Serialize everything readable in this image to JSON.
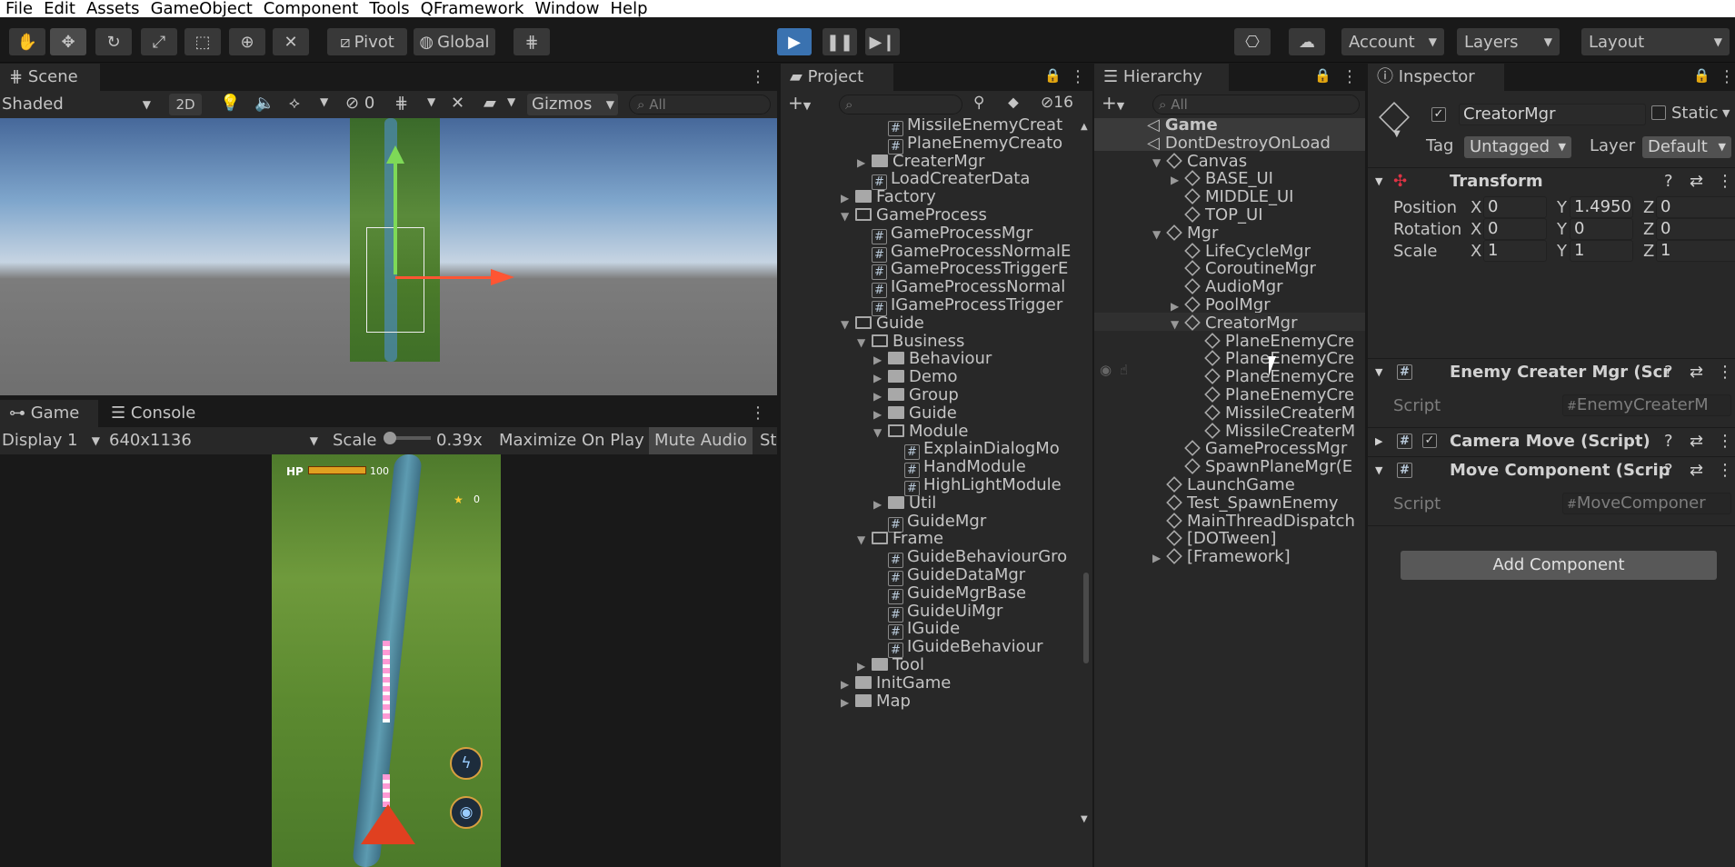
{
  "menu": [
    "File",
    "Edit",
    "Assets",
    "GameObject",
    "Component",
    "Tools",
    "QFramework",
    "Window",
    "Help"
  ],
  "toolbar": {
    "pivot": "Pivot",
    "global": "Global",
    "account": "Account",
    "layers": "Layers",
    "layout": "Layout"
  },
  "scene": {
    "tab": "Scene",
    "shading": "Shaded",
    "mode2d": "2D",
    "hidden_count": "0",
    "gizmos": "Gizmos",
    "search_placeholder": "All"
  },
  "game": {
    "tab": "Game",
    "console_tab": "Console",
    "display": "Display 1",
    "resolution": "640x1136",
    "scale_label": "Scale",
    "scale_value": "0.39x",
    "maximize": "Maximize On Play",
    "mute": "Mute Audio",
    "stats": "St",
    "hp_label": "HP",
    "hp_value": "100",
    "score": "0"
  },
  "project": {
    "tab": "Project",
    "hidden_count": "16",
    "items": [
      {
        "label": "MissileEnemyCreat",
        "indent": 128,
        "kind": "script"
      },
      {
        "label": "PlaneEnemyCreato",
        "indent": 128,
        "kind": "script"
      },
      {
        "label": "CreaterMgr",
        "indent": 110,
        "kind": "folder",
        "arrow": "▶"
      },
      {
        "label": "LoadCreaterData",
        "indent": 110,
        "kind": "script"
      },
      {
        "label": "Factory",
        "indent": 92,
        "kind": "folder",
        "arrow": "▶"
      },
      {
        "label": "GameProcess",
        "indent": 92,
        "kind": "folderopen",
        "arrow": "▼"
      },
      {
        "label": "GameProcessMgr",
        "indent": 110,
        "kind": "script"
      },
      {
        "label": "GameProcessNormalE",
        "indent": 110,
        "kind": "script"
      },
      {
        "label": "GameProcessTriggerE",
        "indent": 110,
        "kind": "script"
      },
      {
        "label": "IGameProcessNormal",
        "indent": 110,
        "kind": "script"
      },
      {
        "label": "IGameProcessTrigger",
        "indent": 110,
        "kind": "script"
      },
      {
        "label": "Guide",
        "indent": 92,
        "kind": "folderopen",
        "arrow": "▼"
      },
      {
        "label": "Business",
        "indent": 110,
        "kind": "folderopen",
        "arrow": "▼"
      },
      {
        "label": "Behaviour",
        "indent": 128,
        "kind": "folder",
        "arrow": "▶"
      },
      {
        "label": "Demo",
        "indent": 128,
        "kind": "folder",
        "arrow": "▶"
      },
      {
        "label": "Group",
        "indent": 128,
        "kind": "folder",
        "arrow": "▶"
      },
      {
        "label": "Guide",
        "indent": 128,
        "kind": "folder",
        "arrow": "▶"
      },
      {
        "label": "Module",
        "indent": 128,
        "kind": "folderopen",
        "arrow": "▼"
      },
      {
        "label": "ExplainDialogMo",
        "indent": 146,
        "kind": "script"
      },
      {
        "label": "HandModule",
        "indent": 146,
        "kind": "script"
      },
      {
        "label": "HighLightModule",
        "indent": 146,
        "kind": "script"
      },
      {
        "label": "Util",
        "indent": 128,
        "kind": "folder",
        "arrow": "▶"
      },
      {
        "label": "GuideMgr",
        "indent": 128,
        "kind": "script"
      },
      {
        "label": "Frame",
        "indent": 110,
        "kind": "folderopen",
        "arrow": "▼"
      },
      {
        "label": "GuideBehaviourGro",
        "indent": 128,
        "kind": "script"
      },
      {
        "label": "GuideDataMgr",
        "indent": 128,
        "kind": "script"
      },
      {
        "label": "GuideMgrBase",
        "indent": 128,
        "kind": "script"
      },
      {
        "label": "GuideUiMgr",
        "indent": 128,
        "kind": "script"
      },
      {
        "label": "IGuide",
        "indent": 128,
        "kind": "script"
      },
      {
        "label": "IGuideBehaviour",
        "indent": 128,
        "kind": "script"
      },
      {
        "label": "Tool",
        "indent": 110,
        "kind": "folder",
        "arrow": "▶"
      },
      {
        "label": "InitGame",
        "indent": 92,
        "kind": "folder",
        "arrow": "▶"
      },
      {
        "label": "Map",
        "indent": 92,
        "kind": "folder",
        "arrow": "▶"
      }
    ]
  },
  "hierarchy": {
    "tab": "Hierarchy",
    "search_placeholder": "All",
    "items": [
      {
        "label": "Game",
        "indent": 68,
        "kind": "scene",
        "bold": true
      },
      {
        "label": "DontDestroyOnLoad",
        "indent": 68,
        "kind": "scene"
      },
      {
        "label": "Canvas",
        "indent": 90,
        "kind": "go",
        "arrow": "▼"
      },
      {
        "label": "BASE_UI",
        "indent": 110,
        "kind": "go",
        "arrow": "▶"
      },
      {
        "label": "MIDDLE_UI",
        "indent": 110,
        "kind": "go"
      },
      {
        "label": "TOP_UI",
        "indent": 110,
        "kind": "go"
      },
      {
        "label": "Mgr",
        "indent": 90,
        "kind": "go",
        "arrow": "▼"
      },
      {
        "label": "LifeCycleMgr",
        "indent": 110,
        "kind": "go"
      },
      {
        "label": "CoroutineMgr",
        "indent": 110,
        "kind": "go"
      },
      {
        "label": "AudioMgr",
        "indent": 110,
        "kind": "go"
      },
      {
        "label": "PoolMgr",
        "indent": 110,
        "kind": "go",
        "arrow": "▶"
      },
      {
        "label": "CreatorMgr",
        "indent": 110,
        "kind": "go",
        "arrow": "▼"
      },
      {
        "label": "PlaneEnemyCre",
        "indent": 132,
        "kind": "go"
      },
      {
        "label": "PlaneEnemyCre",
        "indent": 132,
        "kind": "go"
      },
      {
        "label": "PlaneEnemyCre",
        "indent": 132,
        "kind": "go"
      },
      {
        "label": "PlaneEnemyCre",
        "indent": 132,
        "kind": "go"
      },
      {
        "label": "MissileCreaterM",
        "indent": 132,
        "kind": "go"
      },
      {
        "label": "MissileCreaterM",
        "indent": 132,
        "kind": "go"
      },
      {
        "label": "GameProcessMgr",
        "indent": 110,
        "kind": "go"
      },
      {
        "label": "SpawnPlaneMgr(E",
        "indent": 110,
        "kind": "go"
      },
      {
        "label": "LaunchGame",
        "indent": 90,
        "kind": "go"
      },
      {
        "label": "Test_SpawnEnemy",
        "indent": 90,
        "kind": "go"
      },
      {
        "label": "MainThreadDispatch",
        "indent": 90,
        "kind": "go"
      },
      {
        "label": "[DOTween]",
        "indent": 90,
        "kind": "go"
      },
      {
        "label": "[Framework]",
        "indent": 90,
        "kind": "go",
        "arrow": "▶"
      }
    ]
  },
  "inspector": {
    "tab": "Inspector",
    "object_name": "CreatorMgr",
    "static_label": "Static",
    "tag_label": "Tag",
    "tag_value": "Untagged",
    "layer_label": "Layer",
    "layer_value": "Default",
    "transform": {
      "title": "Transform",
      "position_label": "Position",
      "rotation_label": "Rotation",
      "scale_label": "Scale",
      "axis_x": "X",
      "axis_y": "Y",
      "axis_z": "Z",
      "position": [
        "0",
        "1.4950",
        "0"
      ],
      "rotation": [
        "0",
        "0",
        "0"
      ],
      "scale": [
        "1",
        "1",
        "1"
      ]
    },
    "enemy_creater": {
      "title": "Enemy Creater Mgr (Scr",
      "script_label": "Script",
      "script_value": "EnemyCreaterM"
    },
    "camera_move": {
      "title": "Camera Move (Script)"
    },
    "move_component": {
      "title": "Move Component (Scrip",
      "script_label": "Script",
      "script_value": "MoveComponer"
    },
    "add_component": "Add Component"
  },
  "colors": {
    "accent": "#3a72b0",
    "selection": "#2c5d87",
    "play_active": "#2a5c8c",
    "gizmo_y": "#7ed957",
    "gizmo_x": "#ff5533"
  }
}
